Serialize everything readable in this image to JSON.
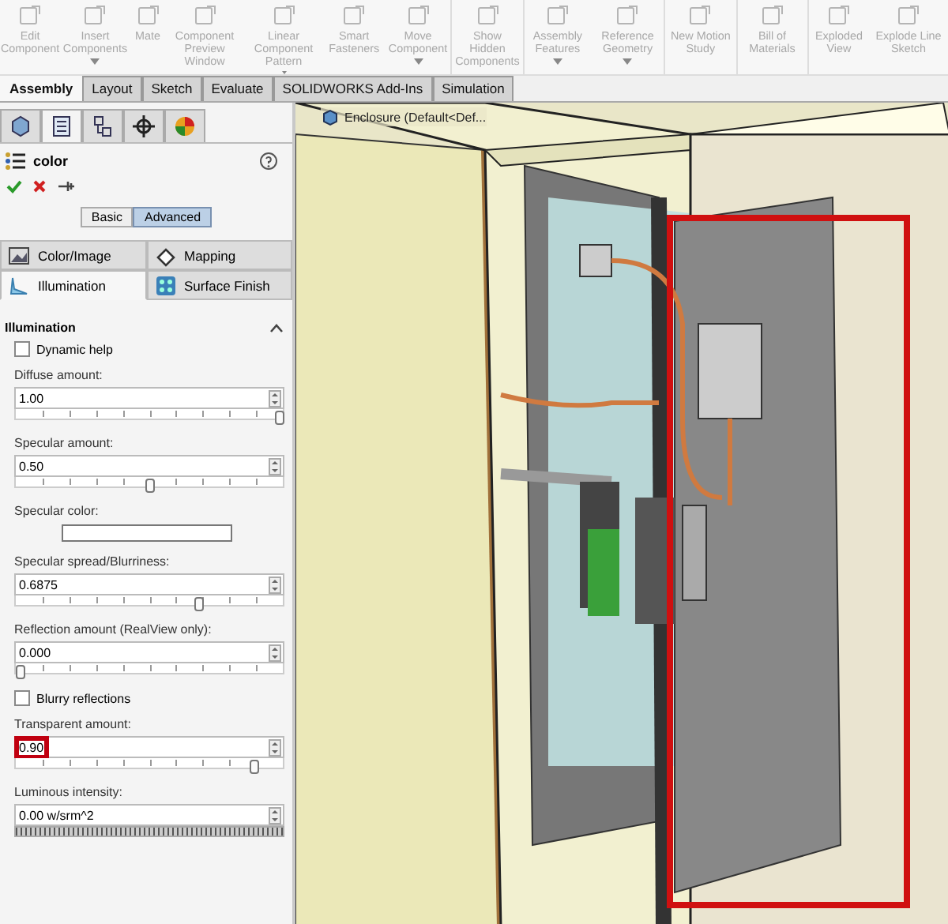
{
  "toolbar": {
    "groups": [
      [
        {
          "label": "Edit Component",
          "disabled": true,
          "dropdown": false
        },
        {
          "label": "Insert Components",
          "disabled": true,
          "dropdown": true
        },
        {
          "label": "Mate",
          "disabled": true,
          "dropdown": false
        },
        {
          "label": "Component Preview Window",
          "disabled": true,
          "dropdown": false
        },
        {
          "label": "Linear Component Pattern",
          "disabled": true,
          "dropdown": true
        },
        {
          "label": "Smart Fasteners",
          "disabled": true,
          "dropdown": false
        },
        {
          "label": "Move Component",
          "disabled": true,
          "dropdown": true
        }
      ],
      [
        {
          "label": "Show Hidden Components",
          "disabled": true,
          "dropdown": false
        }
      ],
      [
        {
          "label": "Assembly Features",
          "disabled": true,
          "dropdown": true
        },
        {
          "label": "Reference Geometry",
          "disabled": true,
          "dropdown": true
        }
      ],
      [
        {
          "label": "New Motion Study",
          "disabled": true,
          "dropdown": false
        }
      ],
      [
        {
          "label": "Bill of Materials",
          "disabled": true,
          "dropdown": false
        }
      ],
      [
        {
          "label": "Exploded View",
          "disabled": true,
          "dropdown": false
        },
        {
          "label": "Explode Line Sketch",
          "disabled": true,
          "dropdown": false
        }
      ]
    ]
  },
  "tabs": [
    {
      "label": "Assembly",
      "selected": true
    },
    {
      "label": "Layout",
      "selected": false
    },
    {
      "label": "Sketch",
      "selected": false
    },
    {
      "label": "Evaluate",
      "selected": false
    },
    {
      "label": "SOLIDWORKS Add-Ins",
      "selected": false
    },
    {
      "label": "Simulation",
      "selected": false
    }
  ],
  "panel": {
    "icon_tabs": [
      {
        "kind": "feature",
        "selected": false
      },
      {
        "kind": "property",
        "selected": true
      },
      {
        "kind": "config",
        "selected": false
      },
      {
        "kind": "dimxpert",
        "selected": false
      },
      {
        "kind": "appearance",
        "selected": false
      }
    ],
    "title": "color",
    "mode_buttons": [
      {
        "label": "Basic",
        "selected": false
      },
      {
        "label": "Advanced",
        "selected": true
      }
    ],
    "sub_tabs": [
      {
        "label": "Color/Image",
        "kind": "image",
        "selected": false
      },
      {
        "label": "Mapping",
        "kind": "mapping",
        "selected": false
      },
      {
        "label": "Illumination",
        "kind": "illumination",
        "selected": true
      },
      {
        "label": "Surface Finish",
        "kind": "finish",
        "selected": false
      }
    ],
    "section": {
      "title": "Illumination",
      "expanded": true,
      "fields": [
        {
          "kind": "checkbox",
          "label": "Dynamic help",
          "checked": false
        },
        {
          "kind": "slider",
          "label": "Diffuse amount:",
          "value": "1.00",
          "level": 1
        },
        {
          "kind": "slider",
          "label": "Specular amount:",
          "value": "0.50",
          "level": 0.5
        },
        {
          "kind": "color",
          "label": "Specular color:"
        },
        {
          "kind": "slider",
          "label": "Specular spread/Blurriness:",
          "value": "0.6875",
          "level": 0.69
        },
        {
          "kind": "slider",
          "label": "Reflection amount (RealView only):",
          "value": "0.000",
          "level": 0
        },
        {
          "kind": "checkbox",
          "label": "Blurry reflections",
          "checked": false
        },
        {
          "kind": "slider",
          "label": "Transparent amount:",
          "value": "0.90",
          "level": 0.9,
          "highlighted": true
        },
        {
          "kind": "dense_slider",
          "label": "Luminous intensity:",
          "value": "0.00 w/srm^2"
        }
      ]
    }
  },
  "viewport": {
    "tree_label": "Enclosure (Default<Def...",
    "highlight": true
  }
}
